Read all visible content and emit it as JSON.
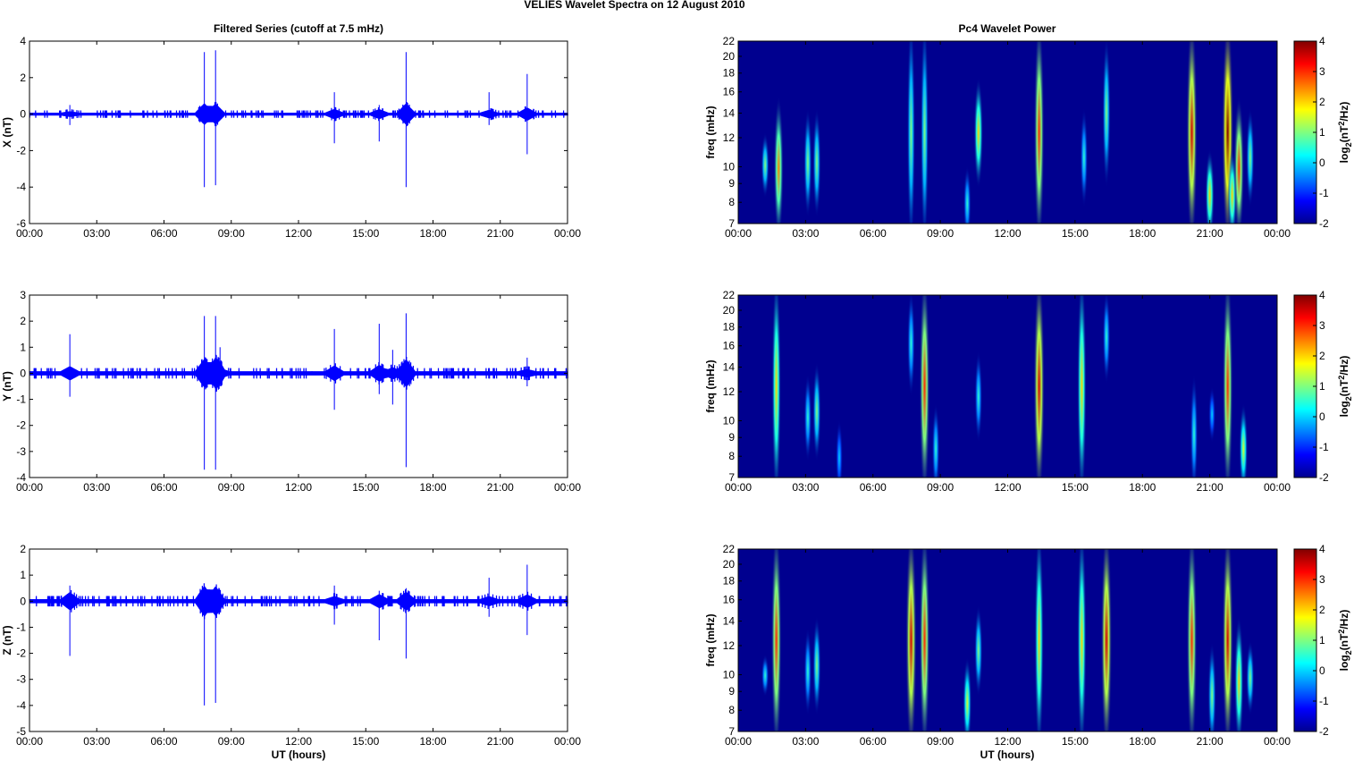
{
  "chart_data": {
    "title": "VELIES Wavelet Spectra on 12 August    2010",
    "left_title": "Filtered Series (cutoff at 7.5 mHz)",
    "right_title": "Pc4 Wavelet Power",
    "xlabel": "UT (hours)",
    "x_ticks": [
      "00:00",
      "03:00",
      "06:00",
      "09:00",
      "12:00",
      "15:00",
      "18:00",
      "21:00",
      "00:00"
    ],
    "xlim": [
      0,
      24
    ],
    "series_color": "#0000ff",
    "time_series": [
      {
        "type": "line",
        "ylabel": "X (nT)",
        "ylim": [
          -6,
          4
        ],
        "yticks": [
          -6,
          -4,
          -2,
          0,
          2,
          4
        ],
        "noise": 0.08,
        "spikes": [
          [
            1.8,
            0.5,
            -0.6
          ],
          [
            7.8,
            3.4,
            -4.0
          ],
          [
            8.3,
            3.5,
            -3.9
          ],
          [
            13.6,
            1.2,
            -1.6
          ],
          [
            15.6,
            0.5,
            -1.5
          ],
          [
            16.8,
            3.4,
            -4.0
          ],
          [
            20.5,
            1.2,
            -0.6
          ],
          [
            22.2,
            2.2,
            -2.2
          ]
        ]
      },
      {
        "type": "line",
        "ylabel": "Y (nT)",
        "ylim": [
          -4,
          3
        ],
        "yticks": [
          -4,
          -3,
          -2,
          -1,
          0,
          1,
          2,
          3
        ],
        "noise": 0.08,
        "spikes": [
          [
            1.8,
            1.5,
            -0.9
          ],
          [
            7.8,
            2.2,
            -3.7
          ],
          [
            8.3,
            2.2,
            -3.7
          ],
          [
            8.5,
            1.0,
            -0.5
          ],
          [
            13.6,
            1.7,
            -1.4
          ],
          [
            15.6,
            1.9,
            -0.8
          ],
          [
            16.2,
            0.9,
            -1.2
          ],
          [
            16.8,
            2.3,
            -3.6
          ],
          [
            22.2,
            0.6,
            -0.5
          ]
        ]
      },
      {
        "type": "line",
        "ylabel": "Z (nT)",
        "ylim": [
          -5,
          2
        ],
        "yticks": [
          -5,
          -4,
          -3,
          -2,
          -1,
          0,
          1,
          2
        ],
        "noise": 0.08,
        "spikes": [
          [
            1.8,
            0.6,
            -2.1
          ],
          [
            7.8,
            0.5,
            -4.0
          ],
          [
            8.3,
            0.5,
            -3.9
          ],
          [
            13.6,
            0.6,
            -0.9
          ],
          [
            15.6,
            0.4,
            -1.5
          ],
          [
            16.8,
            0.5,
            -2.2
          ],
          [
            20.5,
            0.9,
            -0.6
          ],
          [
            22.2,
            1.4,
            -1.3
          ]
        ]
      }
    ],
    "wavelet": {
      "type": "heatmap",
      "ylabel": "freq (mHz)",
      "ylim": [
        7,
        22
      ],
      "yscale": "log",
      "yticks": [
        7,
        8,
        9,
        10,
        12,
        14,
        16,
        18,
        20,
        22
      ],
      "colorbar_label": "log2(nT2/Hz)",
      "colorbar_ticks": [
        -2,
        -1,
        0,
        1,
        2,
        3,
        4
      ],
      "clim": [
        -2,
        4
      ],
      "panels": [
        [
          [
            1.2,
            1,
            8.5,
            12
          ],
          [
            1.8,
            2.5,
            7,
            14
          ],
          [
            3.1,
            1,
            7.5,
            14
          ],
          [
            3.5,
            1,
            7.5,
            14
          ],
          [
            7.7,
            1,
            7,
            22
          ],
          [
            8.3,
            1,
            7,
            22
          ],
          [
            10.2,
            0.5,
            7,
            9
          ],
          [
            10.7,
            2,
            9,
            17
          ],
          [
            13.4,
            3,
            7,
            22
          ],
          [
            15.4,
            0.5,
            8,
            14
          ],
          [
            16.4,
            1,
            9,
            22
          ],
          [
            20.2,
            3.5,
            7,
            22
          ],
          [
            21.0,
            2,
            7,
            10
          ],
          [
            21.8,
            4,
            7,
            22
          ],
          [
            22.0,
            2,
            7,
            10
          ],
          [
            22.3,
            3,
            7,
            14
          ],
          [
            22.8,
            1,
            8,
            14
          ]
        ],
        [
          [
            1.7,
            2,
            7,
            22
          ],
          [
            3.1,
            0.5,
            8,
            13
          ],
          [
            3.5,
            1,
            8,
            14
          ],
          [
            4.5,
            0,
            7,
            9
          ],
          [
            7.7,
            0.5,
            12,
            22
          ],
          [
            8.3,
            3,
            7,
            22
          ],
          [
            8.8,
            0.5,
            7,
            10
          ],
          [
            10.7,
            0.5,
            9,
            15
          ],
          [
            13.4,
            3.5,
            7,
            22
          ],
          [
            15.3,
            2,
            7,
            22
          ],
          [
            16.4,
            0.5,
            13,
            22
          ],
          [
            20.3,
            0.5,
            7,
            12
          ],
          [
            21.1,
            0,
            9,
            12
          ],
          [
            21.8,
            3,
            7,
            22
          ],
          [
            22.5,
            1.5,
            7,
            10
          ]
        ],
        [
          [
            1.2,
            0.5,
            9,
            11
          ],
          [
            1.7,
            3,
            7,
            22
          ],
          [
            3.1,
            0.5,
            8,
            13
          ],
          [
            3.5,
            1,
            8,
            14
          ],
          [
            7.7,
            3.5,
            7,
            22
          ],
          [
            8.3,
            3,
            7,
            22
          ],
          [
            10.2,
            1.5,
            7,
            10
          ],
          [
            10.7,
            1,
            9,
            15
          ],
          [
            13.4,
            2,
            7,
            22
          ],
          [
            15.3,
            2,
            7,
            22
          ],
          [
            16.4,
            3.5,
            7,
            22
          ],
          [
            20.2,
            3,
            7,
            22
          ],
          [
            21.1,
            1,
            7,
            11
          ],
          [
            21.8,
            3.5,
            7,
            22
          ],
          [
            22.3,
            2,
            7,
            13
          ],
          [
            22.8,
            1,
            8,
            12
          ]
        ]
      ]
    }
  }
}
